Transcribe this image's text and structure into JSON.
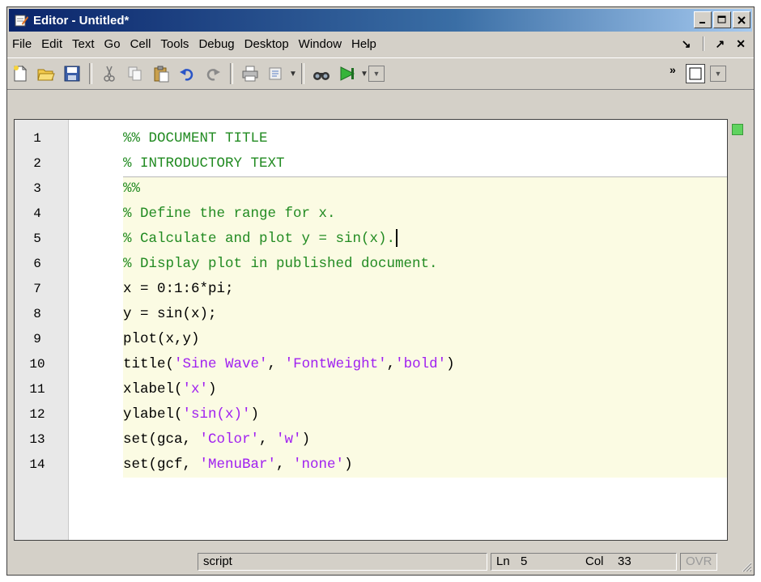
{
  "window": {
    "title": "Editor - Untitled*"
  },
  "menubar": {
    "items": [
      "File",
      "Edit",
      "Text",
      "Go",
      "Cell",
      "Tools",
      "Debug",
      "Desktop",
      "Window",
      "Help"
    ],
    "right": {
      "dock": "↘",
      "undock": "↗",
      "close": "✕"
    }
  },
  "toolbar": {
    "icons": [
      "new-file-icon",
      "open-folder-icon",
      "save-icon",
      "cut-icon",
      "copy-icon",
      "paste-icon",
      "undo-icon",
      "redo-icon",
      "print-icon",
      "publish-icon",
      "find-icon",
      "run-icon",
      "layout-icon"
    ],
    "overflow": "»"
  },
  "editor": {
    "line_numbers": [
      "1",
      "2",
      "3",
      "4",
      "5",
      "6",
      "7",
      "8",
      "9",
      "10",
      "11",
      "12",
      "13",
      "14"
    ]
  },
  "statusbar": {
    "mode": "script",
    "ln_label": "Ln",
    "ln_value": "5",
    "col_label": "Col",
    "col_value": "33",
    "ovr": "OVR"
  },
  "colors": {
    "comment": "#228b22",
    "string": "#a020f0",
    "cell_bg": "#fbfbe3",
    "title_bar": "#0a246a"
  },
  "code_lines": [
    {
      "parts": [
        {
          "t": "%% DOCUMENT TITLE",
          "c": "cm"
        }
      ]
    },
    {
      "parts": [
        {
          "t": "% INTRODUCTORY TEXT",
          "c": "cm"
        }
      ]
    },
    {
      "parts": [
        {
          "t": "%%",
          "c": "cm"
        }
      ]
    },
    {
      "parts": [
        {
          "t": "% Define the range for x.",
          "c": "cm"
        }
      ]
    },
    {
      "parts": [
        {
          "t": "% Calculate and plot y = sin(x).",
          "c": "cm"
        }
      ]
    },
    {
      "parts": [
        {
          "t": "% Display plot in published document.",
          "c": "cm"
        }
      ]
    },
    {
      "parts": [
        {
          "t": "x = 0:1:6*pi;",
          "c": ""
        }
      ]
    },
    {
      "parts": [
        {
          "t": "y = sin(x);",
          "c": ""
        }
      ]
    },
    {
      "parts": [
        {
          "t": "plot(x,y)",
          "c": ""
        }
      ]
    },
    {
      "parts": [
        {
          "t": "title(",
          "c": ""
        },
        {
          "t": "'Sine Wave'",
          "c": "str"
        },
        {
          "t": ", ",
          "c": ""
        },
        {
          "t": "'FontWeight'",
          "c": "str"
        },
        {
          "t": ",",
          "c": ""
        },
        {
          "t": "'bold'",
          "c": "str"
        },
        {
          "t": ")",
          "c": ""
        }
      ]
    },
    {
      "parts": [
        {
          "t": "xlabel(",
          "c": ""
        },
        {
          "t": "'x'",
          "c": "str"
        },
        {
          "t": ")",
          "c": ""
        }
      ]
    },
    {
      "parts": [
        {
          "t": "ylabel(",
          "c": ""
        },
        {
          "t": "'sin(x)'",
          "c": "str"
        },
        {
          "t": ")",
          "c": ""
        }
      ]
    },
    {
      "parts": [
        {
          "t": "set(gca, ",
          "c": ""
        },
        {
          "t": "'Color'",
          "c": "str"
        },
        {
          "t": ", ",
          "c": ""
        },
        {
          "t": "'w'",
          "c": "str"
        },
        {
          "t": ")",
          "c": ""
        }
      ]
    },
    {
      "parts": [
        {
          "t": "set(gcf, ",
          "c": ""
        },
        {
          "t": "'MenuBar'",
          "c": "str"
        },
        {
          "t": ", ",
          "c": ""
        },
        {
          "t": "'none'",
          "c": "str"
        },
        {
          "t": ")",
          "c": ""
        }
      ]
    }
  ]
}
